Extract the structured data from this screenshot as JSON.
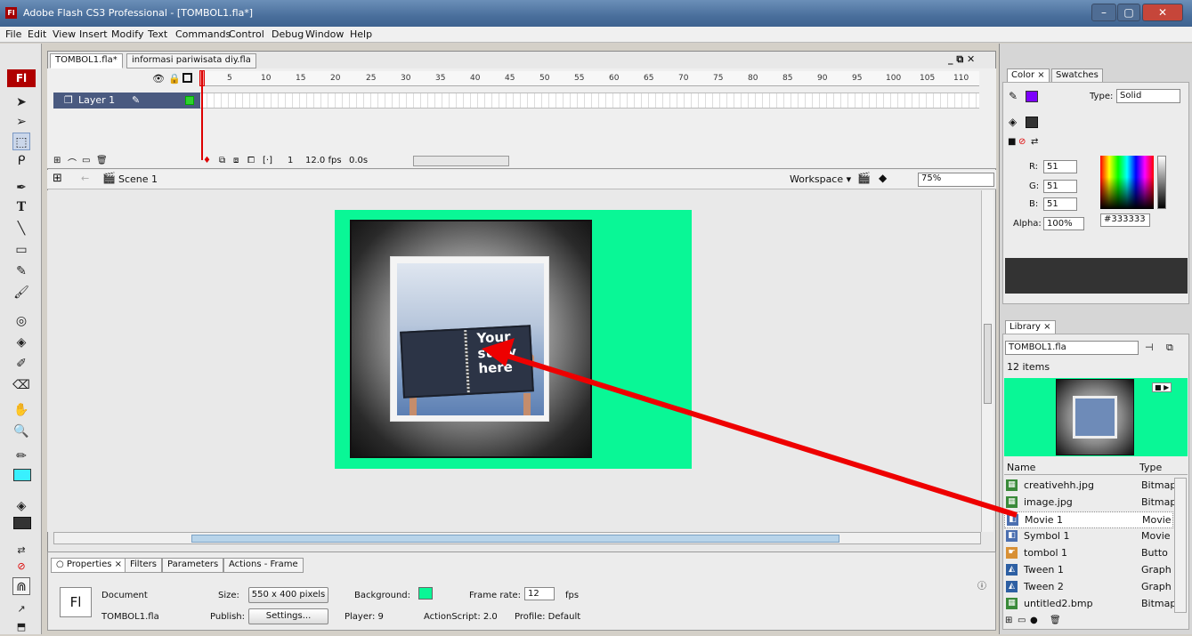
{
  "window": {
    "title": "Adobe Flash CS3 Professional - [TOMBOL1.fla*]",
    "logo": "Fl",
    "min": "–",
    "max": "▢",
    "close": "✕"
  },
  "menu": [
    "File",
    "Edit",
    "View",
    "Insert",
    "Modify",
    "Text",
    "Commands",
    "Control",
    "Debug",
    "Window",
    "Help"
  ],
  "tools": {
    "badge": "Fl"
  },
  "doc_tabs": [
    "TOMBOL1.fla*",
    "informasi pariwisata diy.fla"
  ],
  "doc_controls": "_ ⧉ ✕",
  "timeline": {
    "ticks": [
      "5",
      "10",
      "15",
      "20",
      "25",
      "30",
      "35",
      "40",
      "45",
      "50",
      "55",
      "60",
      "65",
      "70",
      "75",
      "80",
      "85",
      "90",
      "95",
      "100",
      "105",
      "110"
    ],
    "layer_name": "Layer 1",
    "frame": "1",
    "fps": "12.0 fps",
    "time": "0.0s"
  },
  "editbar": {
    "scene": "Scene 1",
    "workspace": "Workspace ▾",
    "zoom": "75%"
  },
  "stage": {
    "book_text": [
      "Your",
      "story",
      "here"
    ]
  },
  "properties": {
    "tabs": [
      "○ Properties ×",
      "Filters",
      "Parameters",
      "Actions - Frame"
    ],
    "doc_label": "Document",
    "doc_name": "TOMBOL1.fla",
    "size_label": "Size:",
    "size_value": "550 x 400 pixels",
    "background_label": "Background:",
    "framerate_label": "Frame rate:",
    "framerate_value": "12",
    "fps_label": "fps",
    "publish_label": "Publish:",
    "settings_button": "Settings...",
    "player": "Player:  9",
    "actionscript": "ActionScript:  2.0",
    "profile": "Profile:  Default",
    "fl_badge": "Fl"
  },
  "color_panel": {
    "tabs": [
      "Color ×",
      "Swatches"
    ],
    "type_label": "Type:",
    "type_value": "Solid",
    "r_label": "R:",
    "r": "51",
    "g_label": "G:",
    "g": "51",
    "b_label": "B:",
    "b": "51",
    "alpha_label": "Alpha:",
    "alpha": "100%",
    "hex": "#333333"
  },
  "library": {
    "tab": "Library ×",
    "file": "TOMBOL1.fla",
    "count": "12 items",
    "col_name": "Name",
    "col_type": "Type",
    "items": [
      {
        "name": "creativehh.jpg",
        "type": "Bitmap",
        "icon": "bitmap-icon"
      },
      {
        "name": "image.jpg",
        "type": "Bitmap",
        "icon": "bitmap-icon"
      },
      {
        "name": "Movie 1",
        "type": "Movie",
        "icon": "movieclip-icon"
      },
      {
        "name": "Symbol 1",
        "type": "Movie",
        "icon": "movieclip-icon"
      },
      {
        "name": "tombol 1",
        "type": "Butto",
        "icon": "button-icon"
      },
      {
        "name": "Tween 1",
        "type": "Graph",
        "icon": "graphic-icon"
      },
      {
        "name": "Tween 2",
        "type": "Graph",
        "icon": "graphic-icon"
      },
      {
        "name": "untitled2.bmp",
        "type": "Bitmap",
        "icon": "bitmap-icon"
      }
    ]
  },
  "colors": {
    "stage_bg": "#09f796",
    "fill": "#333333",
    "arrow": "#ee0000",
    "stroke_swatch": "#7d00ff"
  }
}
